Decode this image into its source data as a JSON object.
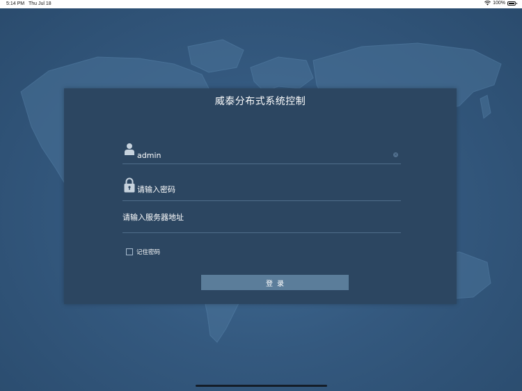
{
  "status_bar": {
    "time": "5:14 PM",
    "date": "Thu Jul 18",
    "battery_text": "100%",
    "battery_level": 1.0
  },
  "login": {
    "title": "威泰分布式系统控制",
    "username_value": "admin",
    "password_placeholder": "请输入密码",
    "server_placeholder": "请输入服务器地址",
    "remember_label": "记住密码",
    "remember_checked": false,
    "login_button": "登录"
  },
  "icons": {
    "user": "user-icon",
    "lock": "lock-icon",
    "clear": "clear-icon",
    "wifi": "wifi-icon",
    "battery": "battery-icon"
  },
  "colors": {
    "background": "#34597f",
    "panel": "#2c4661",
    "button": "#5b7d9a",
    "text": "#ffffff"
  }
}
